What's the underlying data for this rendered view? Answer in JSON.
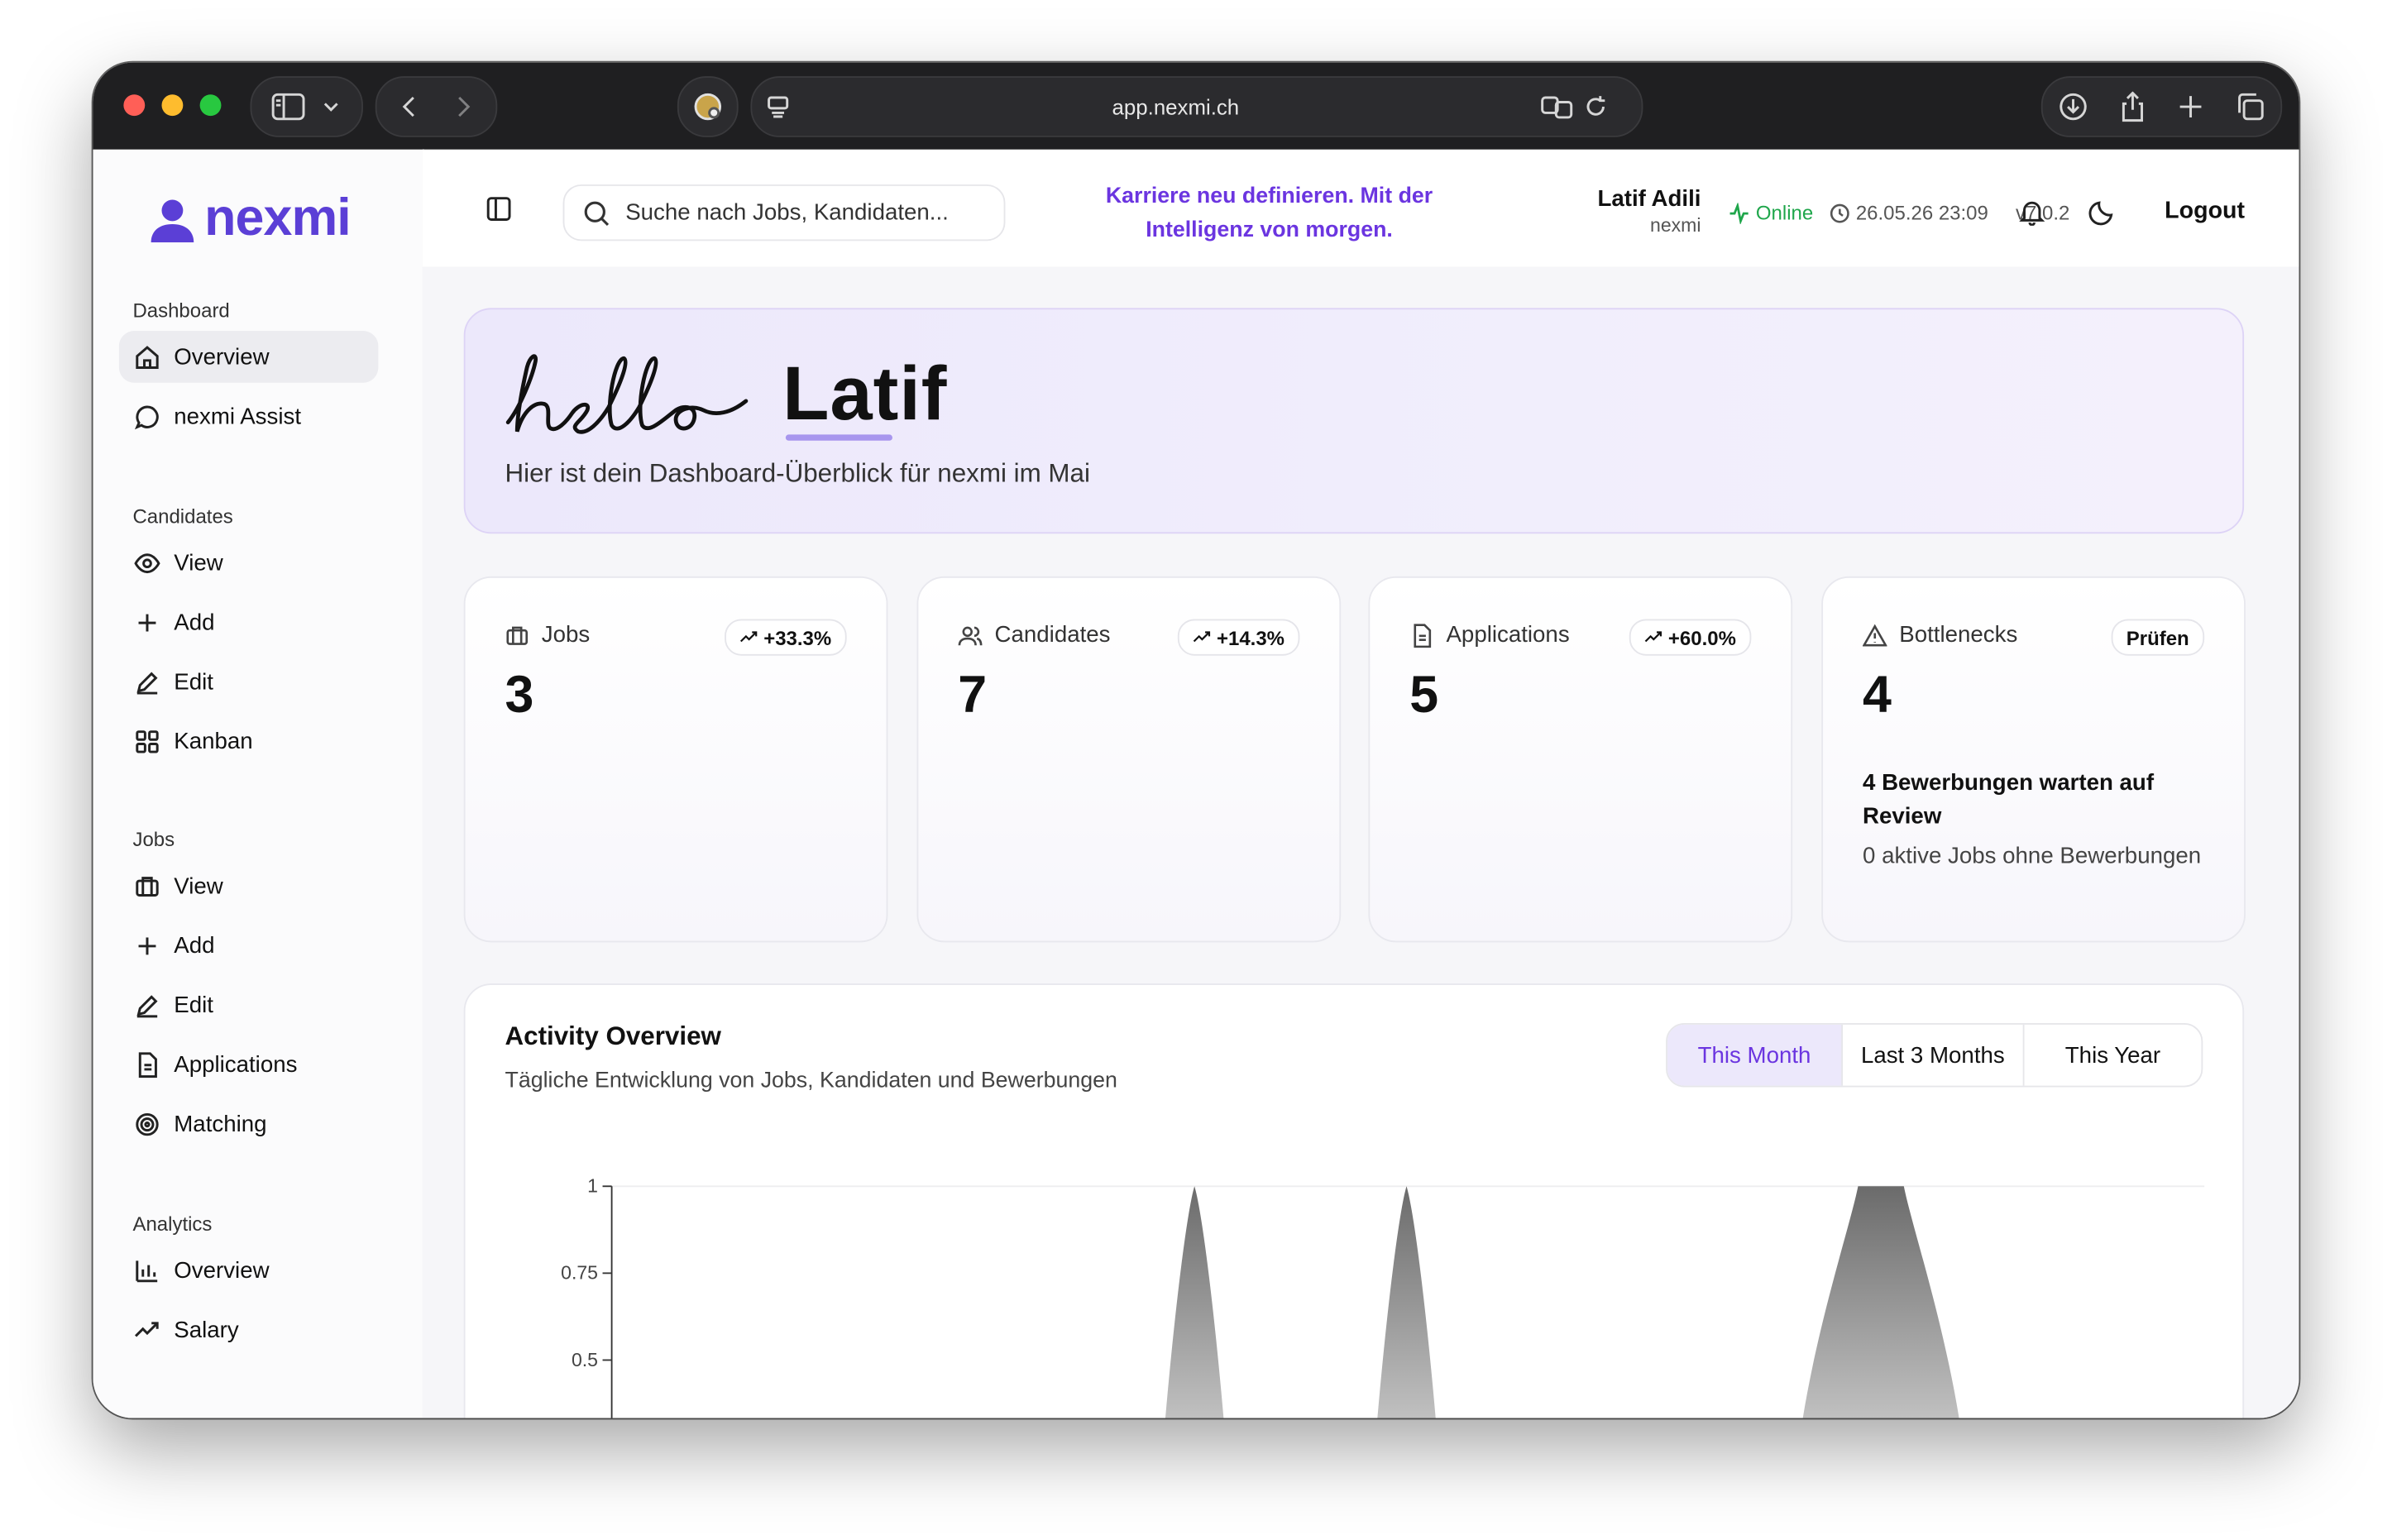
{
  "browser": {
    "url": "app.nexmi.ch"
  },
  "sidebar": {
    "logo_text": "nexmi",
    "sections": [
      {
        "title": "Dashboard",
        "items": [
          {
            "label": "Overview",
            "icon": "home-icon",
            "active": true
          },
          {
            "label": "nexmi Assist",
            "icon": "chat-bubble-icon",
            "active": false
          }
        ]
      },
      {
        "title": "Candidates",
        "items": [
          {
            "label": "View",
            "icon": "eye-icon",
            "active": false
          },
          {
            "label": "Add",
            "icon": "plus-icon",
            "active": false
          },
          {
            "label": "Edit",
            "icon": "pencil-icon",
            "active": false
          },
          {
            "label": "Kanban",
            "icon": "grid-icon",
            "active": false
          }
        ]
      },
      {
        "title": "Jobs",
        "items": [
          {
            "label": "View",
            "icon": "briefcase-icon",
            "active": false
          },
          {
            "label": "Add",
            "icon": "plus-icon",
            "active": false
          },
          {
            "label": "Edit",
            "icon": "pencil-icon",
            "active": false
          },
          {
            "label": "Applications",
            "icon": "document-icon",
            "active": false
          },
          {
            "label": "Matching",
            "icon": "target-icon",
            "active": false
          }
        ]
      },
      {
        "title": "Analytics",
        "items": [
          {
            "label": "Overview",
            "icon": "bar-chart-icon",
            "active": false
          },
          {
            "label": "Salary",
            "icon": "trend-up-icon",
            "active": false
          }
        ]
      }
    ]
  },
  "header": {
    "search_placeholder": "Suche nach Jobs, Kandidaten...",
    "tagline": "Karriere neu definieren. Mit der Intelligenz von morgen.",
    "user_name": "Latif Adili",
    "user_org": "nexmi",
    "status": "Online",
    "datetime": "26.05.26 23:09",
    "version": "v7.0.2",
    "logout_label": "Logout"
  },
  "hero": {
    "greeting": "hello",
    "name": "Latif",
    "subtitle": "Hier ist dein Dashboard-Überblick für nexmi im Mai"
  },
  "stats": [
    {
      "title": "Jobs",
      "value": "3",
      "badge": "+33.3%",
      "icon": "briefcase-icon"
    },
    {
      "title": "Candidates",
      "value": "7",
      "badge": "+14.3%",
      "icon": "users-icon"
    },
    {
      "title": "Applications",
      "value": "5",
      "badge": "+60.0%",
      "icon": "document-icon"
    },
    {
      "title": "Bottlenecks",
      "value": "4",
      "badge": "Prüfen",
      "icon": "warning-icon",
      "line1": "4 Bewerbungen warten auf Review",
      "line2": "0 aktive Jobs ohne Bewerbungen"
    }
  ],
  "activity": {
    "title": "Activity Overview",
    "subtitle": "Tägliche Entwicklung von Jobs, Kandidaten und Bewerbungen",
    "ranges": [
      "This Month",
      "Last 3 Months",
      "This Year"
    ],
    "active_range": "This Month"
  },
  "chart_data": {
    "type": "area",
    "y_ticks": [
      "1",
      "0.75",
      "0.5"
    ],
    "ylim": [
      0,
      1
    ],
    "peaks": [
      {
        "label": "peak-1",
        "value": 1
      },
      {
        "label": "peak-2",
        "value": 1
      },
      {
        "label": "peak-3",
        "value": 1
      }
    ]
  },
  "colors": {
    "brand": "#5b3fd6",
    "accent": "#6b35e0",
    "online": "#1fa64b"
  }
}
